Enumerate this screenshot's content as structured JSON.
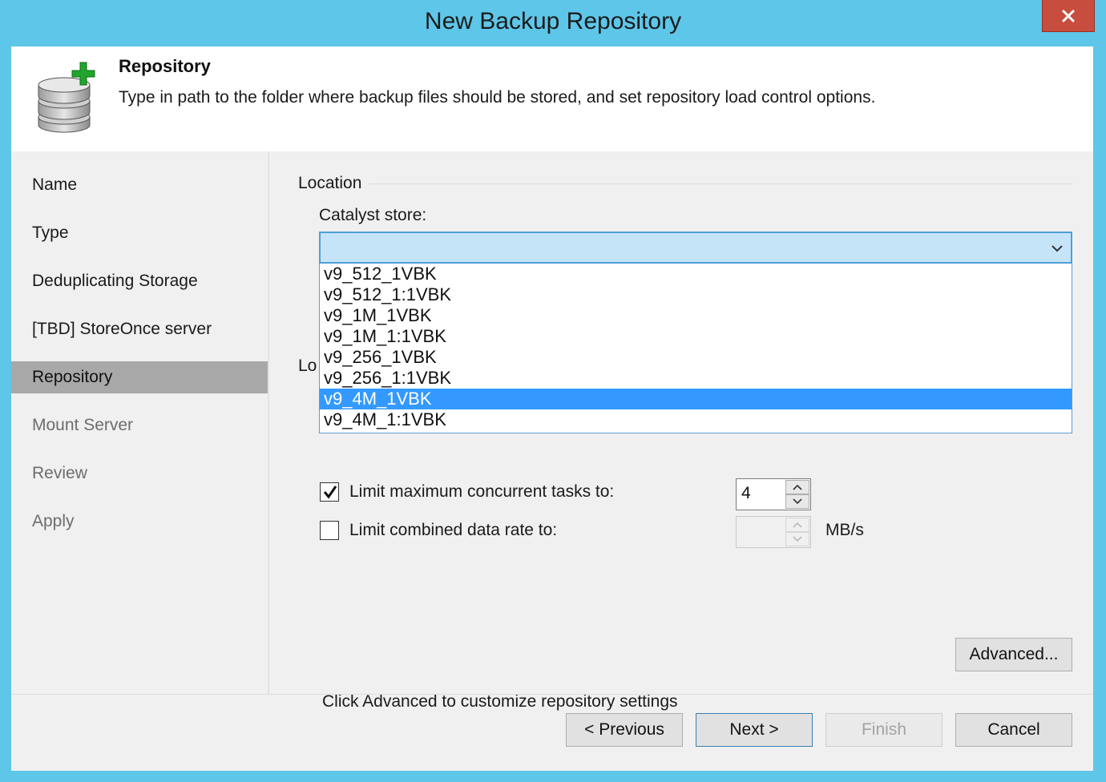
{
  "window": {
    "title": "New Backup Repository",
    "close_label": "✕"
  },
  "header": {
    "title": "Repository",
    "description": "Type in path to the folder where backup files should be stored, and set repository load control options."
  },
  "sidebar": {
    "items": [
      {
        "label": "Name",
        "state": "done"
      },
      {
        "label": "Type",
        "state": "done"
      },
      {
        "label": "Deduplicating Storage",
        "state": "done"
      },
      {
        "label": "[TBD] StoreOnce server",
        "state": "done"
      },
      {
        "label": "Repository",
        "state": "active"
      },
      {
        "label": "Mount Server",
        "state": "future"
      },
      {
        "label": "Review",
        "state": "future"
      },
      {
        "label": "Apply",
        "state": "future"
      }
    ]
  },
  "location": {
    "section_label": "Location",
    "catalyst_label": "Catalyst store:",
    "catalyst_value": "",
    "options": [
      "v9_512_1VBK",
      "v9_512_1:1VBK",
      "v9_1M_1VBK",
      "v9_1M_1:1VBK",
      "v9_256_1VBK",
      "v9_256_1:1VBK",
      "v9_4M_1VBK",
      "v9_4M_1:1VBK"
    ],
    "highlighted_option": "v9_4M_1VBK"
  },
  "load_control": {
    "section_label_partial": "Lo",
    "limit_tasks": {
      "label": "Limit maximum concurrent tasks to:",
      "checked": true,
      "value": "4"
    },
    "limit_rate": {
      "label": "Limit combined data rate to:",
      "checked": false,
      "value": "",
      "unit": "MB/s"
    }
  },
  "advanced": {
    "hint": "Click Advanced to customize repository settings",
    "button_label": "Advanced..."
  },
  "footer": {
    "previous_label": "< Previous",
    "next_label": "Next >",
    "finish_label": "Finish",
    "cancel_label": "Cancel"
  },
  "colors": {
    "title_bar": "#5ec6e8",
    "selection": "#3399ff",
    "combo_focus": "#c6e4f8",
    "sidebar_active": "#a8a8a8"
  }
}
